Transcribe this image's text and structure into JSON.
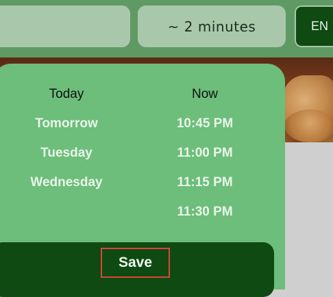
{
  "header": {
    "search_value": "",
    "eta_label": "~ 2 minutes",
    "language_label": "EN"
  },
  "scheduler": {
    "days_header": "Today",
    "times_header": "Now",
    "days": [
      "Tomorrow",
      "Tuesday",
      "Wednesday"
    ],
    "times": [
      "10:45 PM",
      "11:00 PM",
      "11:15 PM",
      "11:30 PM"
    ],
    "save_label": "Save"
  },
  "colors": {
    "header_bg": "#5f9a64",
    "pill_bg": "#a9c8ab",
    "panel_bg": "#6dbd7b",
    "brand_dark": "#0e4a12",
    "highlight_border": "#e0443a"
  },
  "icons": {
    "photo": "food-photo"
  }
}
